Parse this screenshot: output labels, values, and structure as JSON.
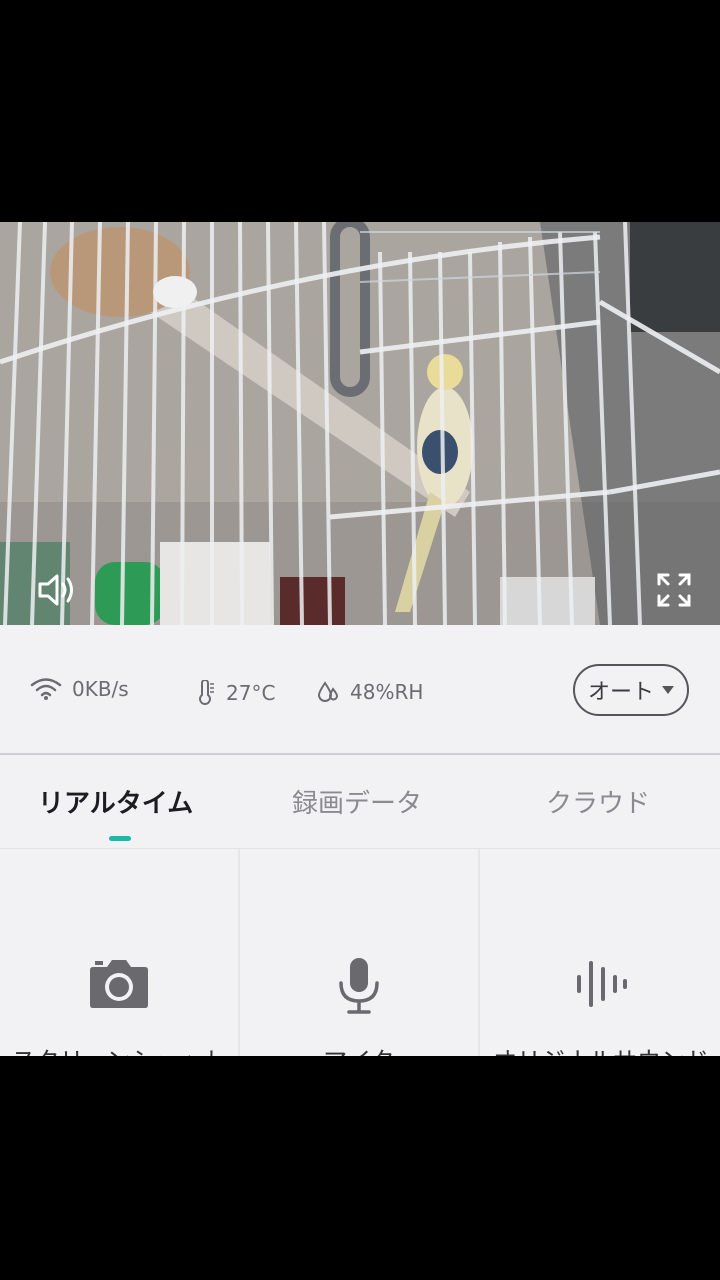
{
  "video": {
    "sound_icon": "speaker-icon",
    "fullscreen_icon": "fullscreen-icon"
  },
  "status": {
    "bitrate": "0KB/s",
    "temperature": "27°C",
    "humidity": "48%RH",
    "quality_label": "オート"
  },
  "tabs": [
    {
      "label": "リアルタイム",
      "active": true
    },
    {
      "label": "録画データ",
      "active": false
    },
    {
      "label": "クラウド",
      "active": false
    }
  ],
  "functions": [
    {
      "label": "スクリーンショット",
      "icon": "camera-icon"
    },
    {
      "label": "マイク",
      "icon": "microphone-icon"
    },
    {
      "label": "オリジナルサウンド",
      "icon": "sound-wave-icon"
    }
  ],
  "colors": {
    "accent": "#1fb8a8",
    "background": "#f2f2f4",
    "text_muted": "#6c6c70"
  }
}
